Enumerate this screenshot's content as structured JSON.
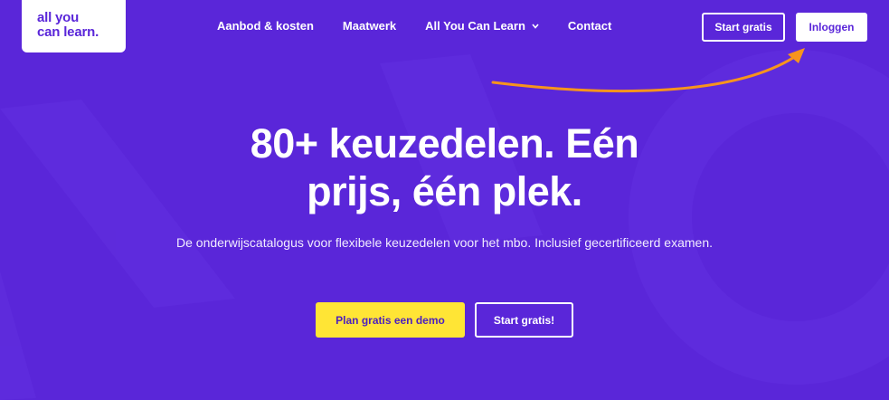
{
  "logo": {
    "line1": "all you",
    "line2": "can learn."
  },
  "nav": {
    "items": [
      {
        "label": "Aanbod & kosten"
      },
      {
        "label": "Maatwerk"
      },
      {
        "label": "All You Can Learn"
      },
      {
        "label": "Contact"
      }
    ]
  },
  "header": {
    "start_label": "Start gratis",
    "login_label": "Inloggen"
  },
  "hero": {
    "title_line1": "80+ keuzedelen. Eén",
    "title_line2": "prijs, één plek.",
    "subtitle": "De onderwijscatalogus voor flexibele keuzedelen voor het mbo. Inclusief gecertificeerd examen.",
    "demo_label": "Plan gratis een demo",
    "start_label": "Start gratis!"
  },
  "icons": {
    "dropdown": "chevron-down-icon",
    "annotation": "arrow-annotation-icon"
  },
  "colors": {
    "background": "#5a26d9",
    "accent_yellow": "#ffe535",
    "arrow_orange": "#f7941d",
    "text_light": "#ffffff"
  }
}
